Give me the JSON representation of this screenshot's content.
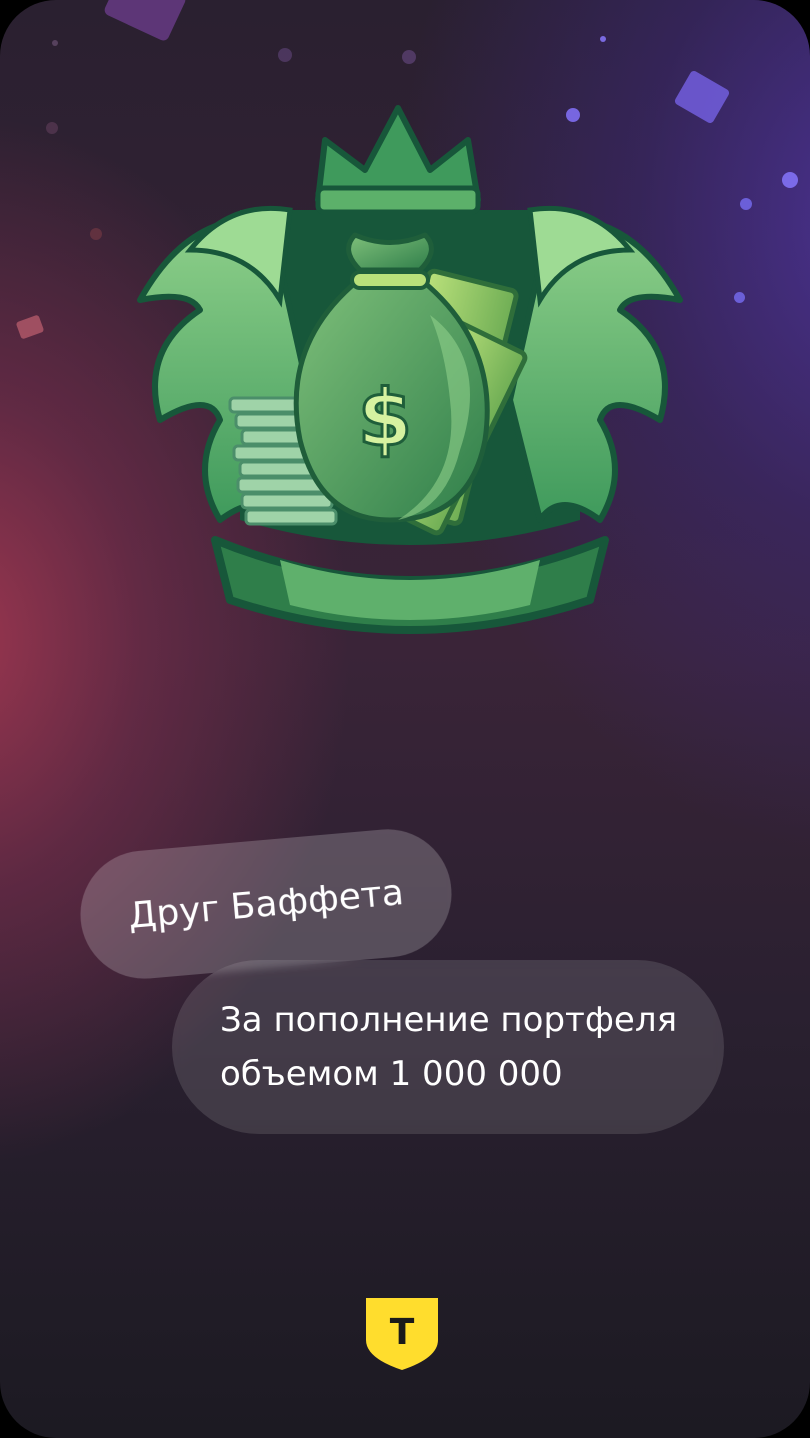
{
  "achievement": {
    "title": "Друг Баффета",
    "description_line1": "За пополнение портфеля",
    "description_line2": "объемом 1 000 000"
  },
  "badge": {
    "icon": "money-bag-crest-icon",
    "bag_symbol": "$"
  },
  "brand": {
    "logo_letter": "Т",
    "logo_color": "#FFDD2D"
  },
  "colors": {
    "badge_dark": "#17573a",
    "badge_mid": "#3f9a5c",
    "badge_light": "#8fd08a"
  }
}
